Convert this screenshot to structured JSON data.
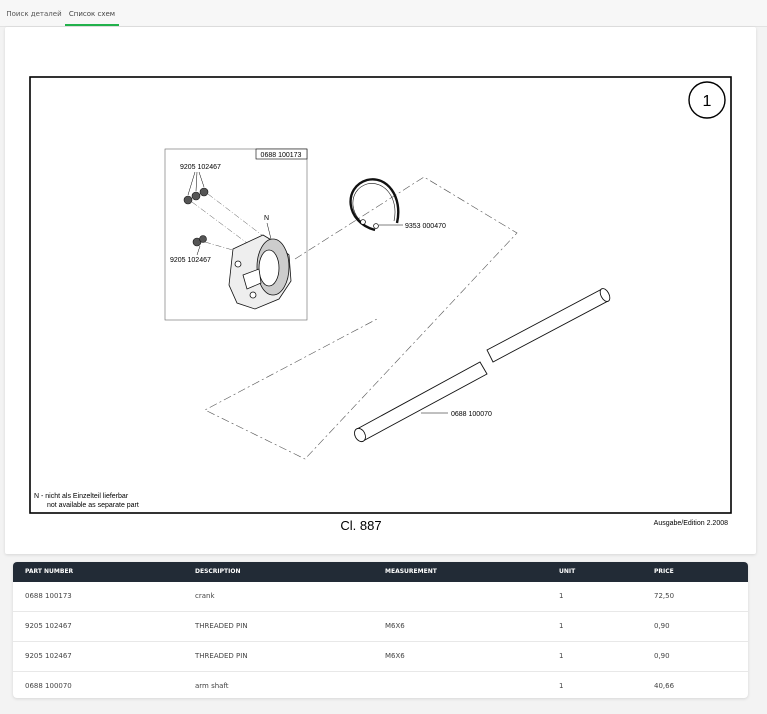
{
  "tabs": [
    {
      "label": "Поиск деталей",
      "active": false
    },
    {
      "label": "Список схем",
      "active": true
    }
  ],
  "diagram": {
    "number": "1",
    "callouts": {
      "crank_box": "0688 100173",
      "pins_top": "9205 102467",
      "pins_bottom": "9205 102467",
      "n_marker": "N",
      "ring": "9353 000470",
      "shaft": "0688 100070"
    },
    "note_line1": "N - nicht als Einzelteil lieferbar",
    "note_line2": "not available as separate part",
    "caption": "Cl. 887",
    "edition": "Ausgabe/Edition  2.2008"
  },
  "table": {
    "headers": [
      "PART NUMBER",
      "DESCRIPTION",
      "MEASUREMENT",
      "UNIT",
      "PRICE"
    ],
    "rows": [
      {
        "part_number": "0688 100173",
        "description": "crank",
        "measurement": "",
        "unit": "1",
        "price": "72,50"
      },
      {
        "part_number": "9205 102467",
        "description": "THREADED PIN",
        "measurement": "M6X6",
        "unit": "1",
        "price": "0,90"
      },
      {
        "part_number": "9205 102467",
        "description": "THREADED PIN",
        "measurement": "M6X6",
        "unit": "1",
        "price": "0,90"
      },
      {
        "part_number": "0688 100070",
        "description": "arm shaft",
        "measurement": "",
        "unit": "1",
        "price": "40,66"
      }
    ]
  },
  "colors": {
    "accent": "#22b24c",
    "header_bg": "#222b36"
  }
}
